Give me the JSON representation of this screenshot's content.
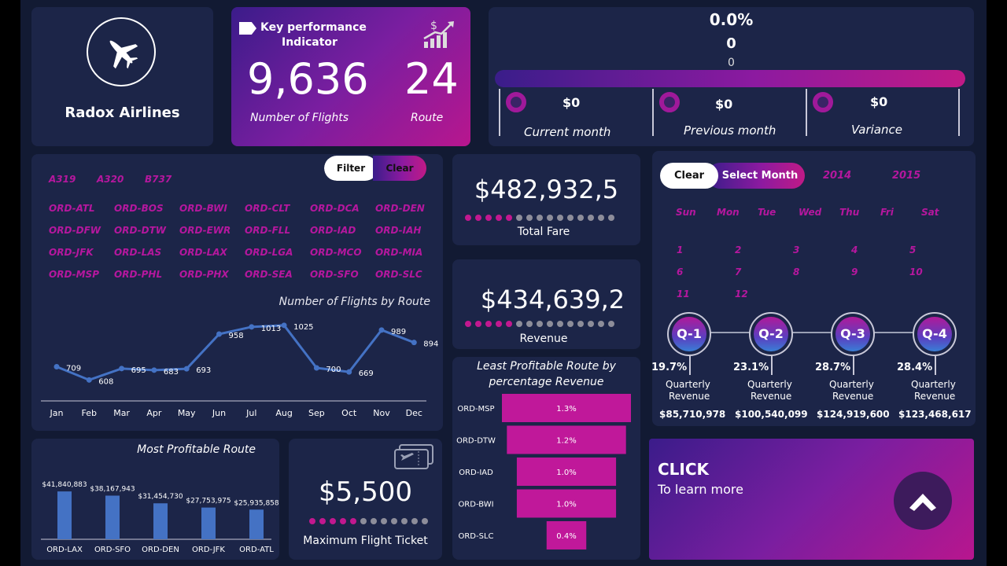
{
  "brand": {
    "name": "Radox Airlines",
    "icon": "airplane-icon"
  },
  "kpi": {
    "title_line1": "Key performance",
    "title_line2": "Indicator",
    "flights_value": "9,636",
    "flights_label": "Number of Flights",
    "route_value": "24",
    "route_label": "Route",
    "icon": "dollar-growth-icon"
  },
  "progress": {
    "percent_text": "0.0%",
    "value_text": "0",
    "value_small": "0",
    "fill_fraction": 1.0,
    "current": {
      "value": "$0",
      "label": "Current month"
    },
    "previous": {
      "value": "$0",
      "label": "Previous month"
    },
    "variance": {
      "value": "$0",
      "label": "Variance"
    }
  },
  "filters": {
    "filter_button": "Filter",
    "clear_button": "Clear",
    "aircraft": [
      "A319",
      "A320",
      "B737"
    ],
    "routes": [
      "ORD-ATL",
      "ORD-BOS",
      "ORD-BWI",
      "ORD-CLT",
      "ORD-DCA",
      "ORD-DEN",
      "ORD-DFW",
      "ORD-DTW",
      "ORD-EWR",
      "ORD-FLL",
      "ORD-IAD",
      "ORD-IAH",
      "ORD-JFK",
      "ORD-LAS",
      "ORD-LAX",
      "ORD-LGA",
      "ORD-MCO",
      "ORD-MIA",
      "ORD-MSP",
      "ORD-PHL",
      "ORD-PHX",
      "ORD-SEA",
      "ORD-SFO",
      "ORD-SLC"
    ]
  },
  "total_fare": {
    "value": "$482,932,5",
    "label": "Total Fare",
    "dots_on": 5,
    "dots_total": 15
  },
  "revenue": {
    "value": "$434,639,2",
    "label": "Revenue",
    "dots_on": 5,
    "dots_total": 15
  },
  "max_ticket": {
    "value": "$5,500",
    "label": "Maximum Flight Ticket",
    "dots_on": 5,
    "dots_total": 12,
    "icon": "ticket-icon"
  },
  "calendar": {
    "clear_button": "Clear",
    "select_button": "Select Month",
    "years": [
      "2014",
      "2015"
    ],
    "weekdays": [
      "Sun",
      "Mon",
      "Tue",
      "Wed",
      "Thu",
      "Fri",
      "Sat"
    ],
    "months": [
      "1",
      "2",
      "3",
      "4",
      "5",
      "6",
      "7",
      "8",
      "9",
      "10",
      "11",
      "12"
    ]
  },
  "quarters": [
    {
      "name": "Q-1",
      "pct": "19.7%",
      "label_line1": "Quarterly",
      "label_line2": "Revenue",
      "amount": "$85,710,978"
    },
    {
      "name": "Q-2",
      "pct": "23.1%",
      "label_line1": "Quarterly",
      "label_line2": "Revenue",
      "amount": "$100,540,099"
    },
    {
      "name": "Q-3",
      "pct": "28.7%",
      "label_line1": "Quarterly",
      "label_line2": "Revenue",
      "amount": "$124,919,600"
    },
    {
      "name": "Q-4",
      "pct": "28.4%",
      "label_line1": "Quarterly",
      "label_line2": "Revenue",
      "amount": "$123,468,617"
    }
  ],
  "cta": {
    "title": "CLICK",
    "subtitle": "To learn more",
    "icon": "chevron-up-icon"
  },
  "chart_data": [
    {
      "type": "line",
      "title": "Number of Flights by Route",
      "categories": [
        "Jan",
        "Feb",
        "Mar",
        "Apr",
        "May",
        "Jun",
        "Jul",
        "Aug",
        "Sep",
        "Oct",
        "Nov",
        "Dec"
      ],
      "values": [
        709,
        608,
        695,
        683,
        693,
        958,
        1013,
        1025,
        700,
        669,
        989,
        894
      ],
      "ylim": [
        400,
        1300
      ],
      "color": "#4472c4"
    },
    {
      "type": "bar",
      "title": "Most Profitable Route",
      "categories": [
        "ORD-LAX",
        "ORD-SFO",
        "ORD-DEN",
        "ORD-JFK",
        "ORD-ATL"
      ],
      "values": [
        41840883,
        38167943,
        31454730,
        27753975,
        25935858
      ],
      "value_labels": [
        "$41,840,883",
        "$38,167,943",
        "$31,454,730",
        "$27,753,975",
        "$25,935,858"
      ],
      "ylim": [
        0,
        55000000
      ],
      "color": "#4472c4"
    },
    {
      "type": "bar",
      "orientation": "horizontal-funnel",
      "title": "Least Profitable Route by percentage Revenue",
      "categories": [
        "ORD-MSP",
        "ORD-DTW",
        "ORD-IAD",
        "ORD-BWI",
        "ORD-SLC"
      ],
      "values": [
        1.3,
        1.2,
        1.0,
        1.0,
        0.4
      ],
      "value_labels": [
        "1.3%",
        "1.2%",
        "1.0%",
        "1.0%",
        "0.4%"
      ],
      "color": "#c0189a"
    }
  ]
}
